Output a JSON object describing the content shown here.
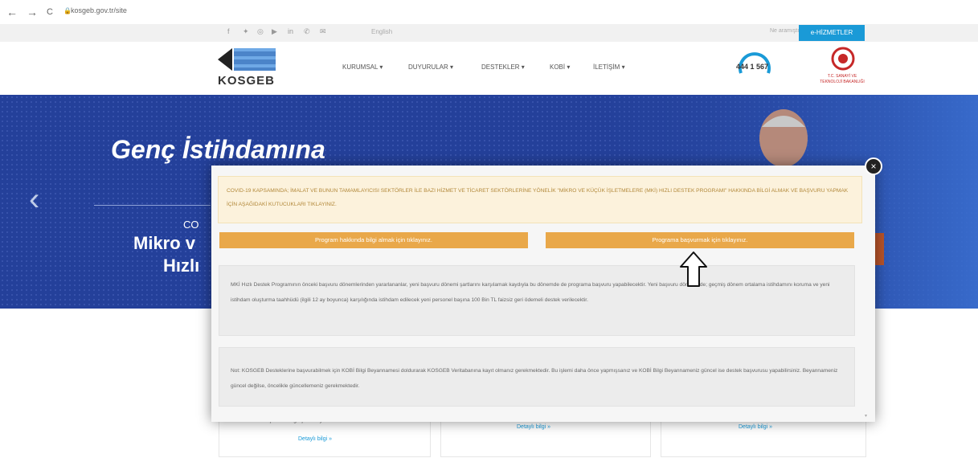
{
  "browser": {
    "back": "←",
    "forward": "→",
    "reload": "C",
    "url": "kosgeb.gov.tr/site"
  },
  "topbar": {
    "social_icons": [
      "facebook-icon",
      "twitter-icon",
      "instagram-icon",
      "youtube-icon",
      "linkedin-icon",
      "phone-icon",
      "mail-icon"
    ],
    "language": "English",
    "search_label": "Ne aramıştınız",
    "eh_button": "e-HİZMETLER"
  },
  "header": {
    "logo": "KOSGEB",
    "menu": [
      "KURUMSAL ▾",
      "DUYURULAR ▾",
      "DESTEKLER ▾",
      "KOBİ ▾",
      "İLETİŞİM ▾"
    ],
    "phone": "444 1 567",
    "ministry": "T.C. SANAYİ VE TEKNOLOJİ BAKANLIĞI",
    "colors": {
      "accent": "#1a9ad7",
      "logo_blue": "#2b6fc0"
    }
  },
  "hero": {
    "title": "Genç İstihdamına",
    "sub1": "CO",
    "sub2": "Mikro v",
    "sub3": "Hızlı",
    "prev_arrow": "‹",
    "bg_color": "#24409a"
  },
  "modal": {
    "close": "×",
    "notice": "COVID-19 KAPSAMINDA; İMALAT VE BUNUN TAMAMLAYICISI SEKTÖRLER İLE BAZI HİZMET VE TİCARET SEKTÖRLERİNE YÖNELİK \"MİKRO VE KÜÇÜK İŞLETMELERE (MKİ) HIZLI DESTEK PROGRAMI\" HAKKINDA BİLGİ ALMAK VE BAŞVURU YAPMAK İÇİN AŞAĞIDAKİ KUTUCUKLARI TIKLAYINIZ.",
    "button_info": "Program hakkında bilgi almak için tıklayınız.",
    "button_apply": "Programa başvurmak için tıklayınız.",
    "text2": "MKİ Hızlı Destek Programının önceki başvuru dönemlerinden yararlananlar, yeni başvuru dönemi şartlarını karşılamak kaydıyla bu dönemde de programa başvuru yapabilecektir. Yeni başvuru döneminde; geçmiş dönem ortalama istihdamını koruma ve yeni istihdam oluşturma taahhüdü (ilgili 12 ay boyunca) karşılığında istihdam edilecek yeni personel başına 100 Bin TL faizsiz geri ödemeli destek verilecektir.",
    "text3": "Not: KOSGEB Desteklerine başvurabilmek için KOBİ Bilgi Beyannamesi doldurarak KOSGEB Veritabanına kayıt olmanız gerekmektedir. Bu işlemi daha önce yapmışsanız ve KOBİ Bilgi Beyannameniz güncel ise destek başvurusu yapabilirsiniz. Beyannameniz güncel değilse, öncelikle güncellemeniz gerekmektedir.",
    "colors": {
      "button": "#e9a84a",
      "notice_bg": "#fcf2dc",
      "notice_text": "#b2883a"
    }
  },
  "cards": {
    "card1_text": "erişilebilir bilgi için tıklayınız",
    "card1_link": "Detaylı bilgi »",
    "card2_link": "Detaylı bilgi »",
    "card3_link": "Detaylı bilgi »"
  }
}
